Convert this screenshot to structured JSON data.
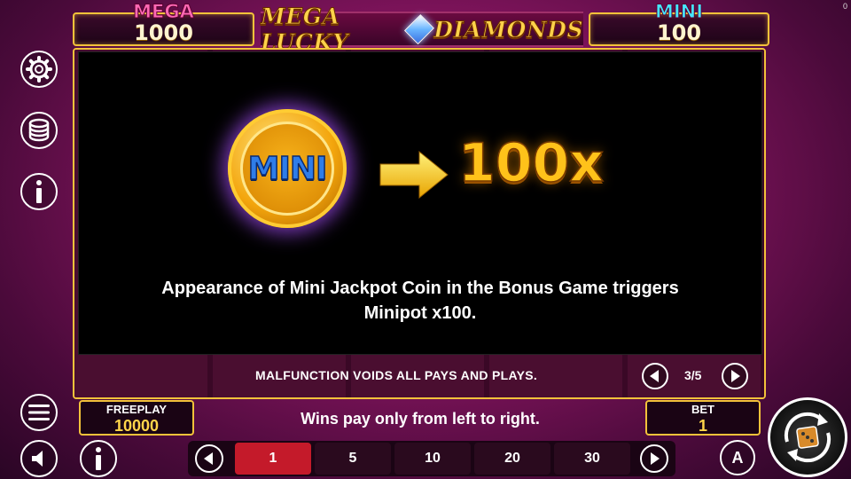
{
  "corner_value": "0",
  "jackpots": {
    "mega": {
      "label": "MEGA",
      "value": "1000"
    },
    "mini": {
      "label": "MINI",
      "value": "100"
    }
  },
  "logo": {
    "left_text": "MEGA LUCKY",
    "right_text": "DIAMONDS"
  },
  "paytable": {
    "coin_label": "MINI",
    "multiplier": "100x",
    "description_line1": "Appearance of Mini Jackpot Coin in the Bonus Game triggers",
    "description_line2": "Minipot x100.",
    "notice": "MALFUNCTION VOIDS ALL PAYS AND PLAYS.",
    "page_indicator": "3/5"
  },
  "freeplay": {
    "label": "FREEPLAY",
    "value": "10000"
  },
  "status_text": "Wins pay only from left to right.",
  "bet": {
    "label": "BET",
    "value": "1"
  },
  "bet_options": [
    "1",
    "5",
    "10",
    "20",
    "30"
  ],
  "selected_bet_index": 0,
  "autoplay_label": "A",
  "colors": {
    "gold_border": "#f3c23a",
    "mega_label": "#ff69b4",
    "mini_label": "#45e6ff",
    "multiplier": "#ffc21a",
    "selected_bet": "#c41a2a"
  },
  "icons": {
    "side": [
      "gear-icon",
      "coins-stack-icon",
      "info-icon",
      "menu-icon",
      "sound-icon",
      "info-icon"
    ],
    "spin": "spin-icon",
    "arrow": "arrow-right-icon"
  }
}
